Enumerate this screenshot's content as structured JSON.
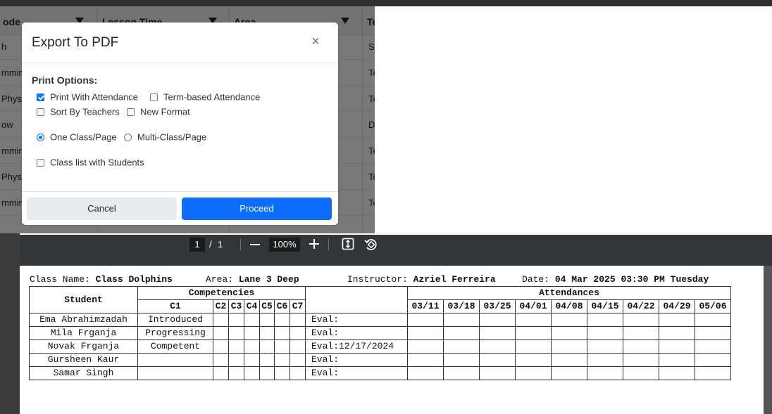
{
  "background_table": {
    "headers": [
      {
        "label": "ode",
        "filter": true
      },
      {
        "label": "Lesson Time",
        "filter": true
      },
      {
        "label": "Area",
        "filter": true
      },
      {
        "label": "Te",
        "filter": false
      }
    ],
    "rows": [
      [
        "h",
        "",
        "",
        "Sa"
      ],
      [
        "mmir",
        "",
        "",
        "Te"
      ],
      [
        "Physi",
        "",
        "",
        "Te"
      ],
      [
        "ow",
        "",
        "",
        "De"
      ],
      [
        "mmir",
        "",
        "",
        "Te"
      ],
      [
        "Physi",
        "",
        "",
        "Te"
      ],
      [
        "mmir",
        "",
        "",
        "Te"
      ]
    ]
  },
  "modal": {
    "title": "Export To PDF",
    "close_symbol": "×",
    "print_options_label": "Print Options:",
    "options": {
      "print_with_attendance": {
        "label": "Print With Attendance",
        "checked": true
      },
      "term_based_attendance": {
        "label": "Term-based Attendance",
        "checked": false
      },
      "sort_by_teachers": {
        "label": "Sort By Teachers",
        "checked": false
      },
      "new_format": {
        "label": "New Format",
        "checked": false
      },
      "one_class_page": {
        "label": "One Class/Page",
        "selected": true
      },
      "multi_class_page": {
        "label": "Multi-Class/Page",
        "selected": false
      },
      "class_list_with_students": {
        "label": "Class list with Students",
        "checked": false
      }
    },
    "cancel_label": "Cancel",
    "proceed_label": "Proceed",
    "accent_color": "#0d6efd"
  },
  "pdf_toolbar": {
    "current_page": "1",
    "separator": "/",
    "total_pages": "1",
    "zoom": "100%"
  },
  "report": {
    "class_name_label": "Class Name:",
    "class_name": "Class Dolphins",
    "area_label": "Area:",
    "area": "Lane 3 Deep",
    "instructor_label": "Instructor:",
    "instructor": "Azriel Ferreira",
    "date_label": "Date:",
    "date": "04 Mar 2025 03:30 PM Tuesday",
    "student_header": "Student",
    "competencies_header": "Competencies",
    "attendances_header": "Attendances",
    "competency_columns": [
      "C1",
      "C2",
      "C3",
      "C4",
      "C5",
      "C6",
      "C7"
    ],
    "attendance_dates": [
      "03/11",
      "03/18",
      "03/25",
      "04/01",
      "04/08",
      "04/15",
      "04/22",
      "04/29",
      "05/06"
    ],
    "students": [
      {
        "name": "Ema Abrahimzadah",
        "c1": "Introduced",
        "eval": "Eval:"
      },
      {
        "name": "Mila Frganja",
        "c1": "Progressing",
        "eval": "Eval:"
      },
      {
        "name": "Novak Frganja",
        "c1": "Competent",
        "eval": "Eval:12/17/2024"
      },
      {
        "name": "Gursheen Kaur",
        "c1": "",
        "eval": "Eval:"
      },
      {
        "name": "Samar Singh",
        "c1": "",
        "eval": "Eval:"
      }
    ]
  }
}
